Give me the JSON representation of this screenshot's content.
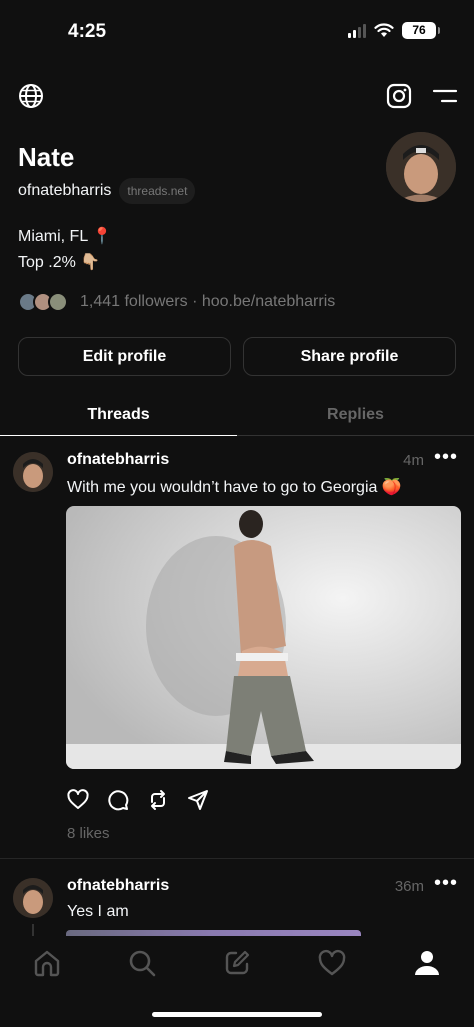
{
  "status_bar": {
    "time": "4:25",
    "battery": "76"
  },
  "top_nav": {
    "globe_icon": "globe-icon",
    "instagram_icon": "instagram-icon",
    "menu_icon": "menu-icon"
  },
  "profile": {
    "name": "Nate",
    "handle": "ofnatebharris",
    "domain_badge": "threads.net",
    "bio_line_1": "Miami, FL 📍",
    "bio_line_2": "Top .2% 👇🏼",
    "followers_text": "1,441 followers · hoo.be/natebharris",
    "edit_button": "Edit profile",
    "share_button": "Share profile"
  },
  "tabs": [
    {
      "label": "Threads",
      "active": true
    },
    {
      "label": "Replies",
      "active": false
    }
  ],
  "posts": [
    {
      "username": "ofnatebharris",
      "time": "4m",
      "text": "With me you wouldn’t have to go to Georgia 🍑",
      "likes": "8 likes"
    },
    {
      "username": "ofnatebharris",
      "time": "36m",
      "text": "Yes I am"
    }
  ],
  "colors": {
    "background": "#101010",
    "text": "#f3f5f7",
    "muted": "#777777",
    "border": "#333333"
  }
}
